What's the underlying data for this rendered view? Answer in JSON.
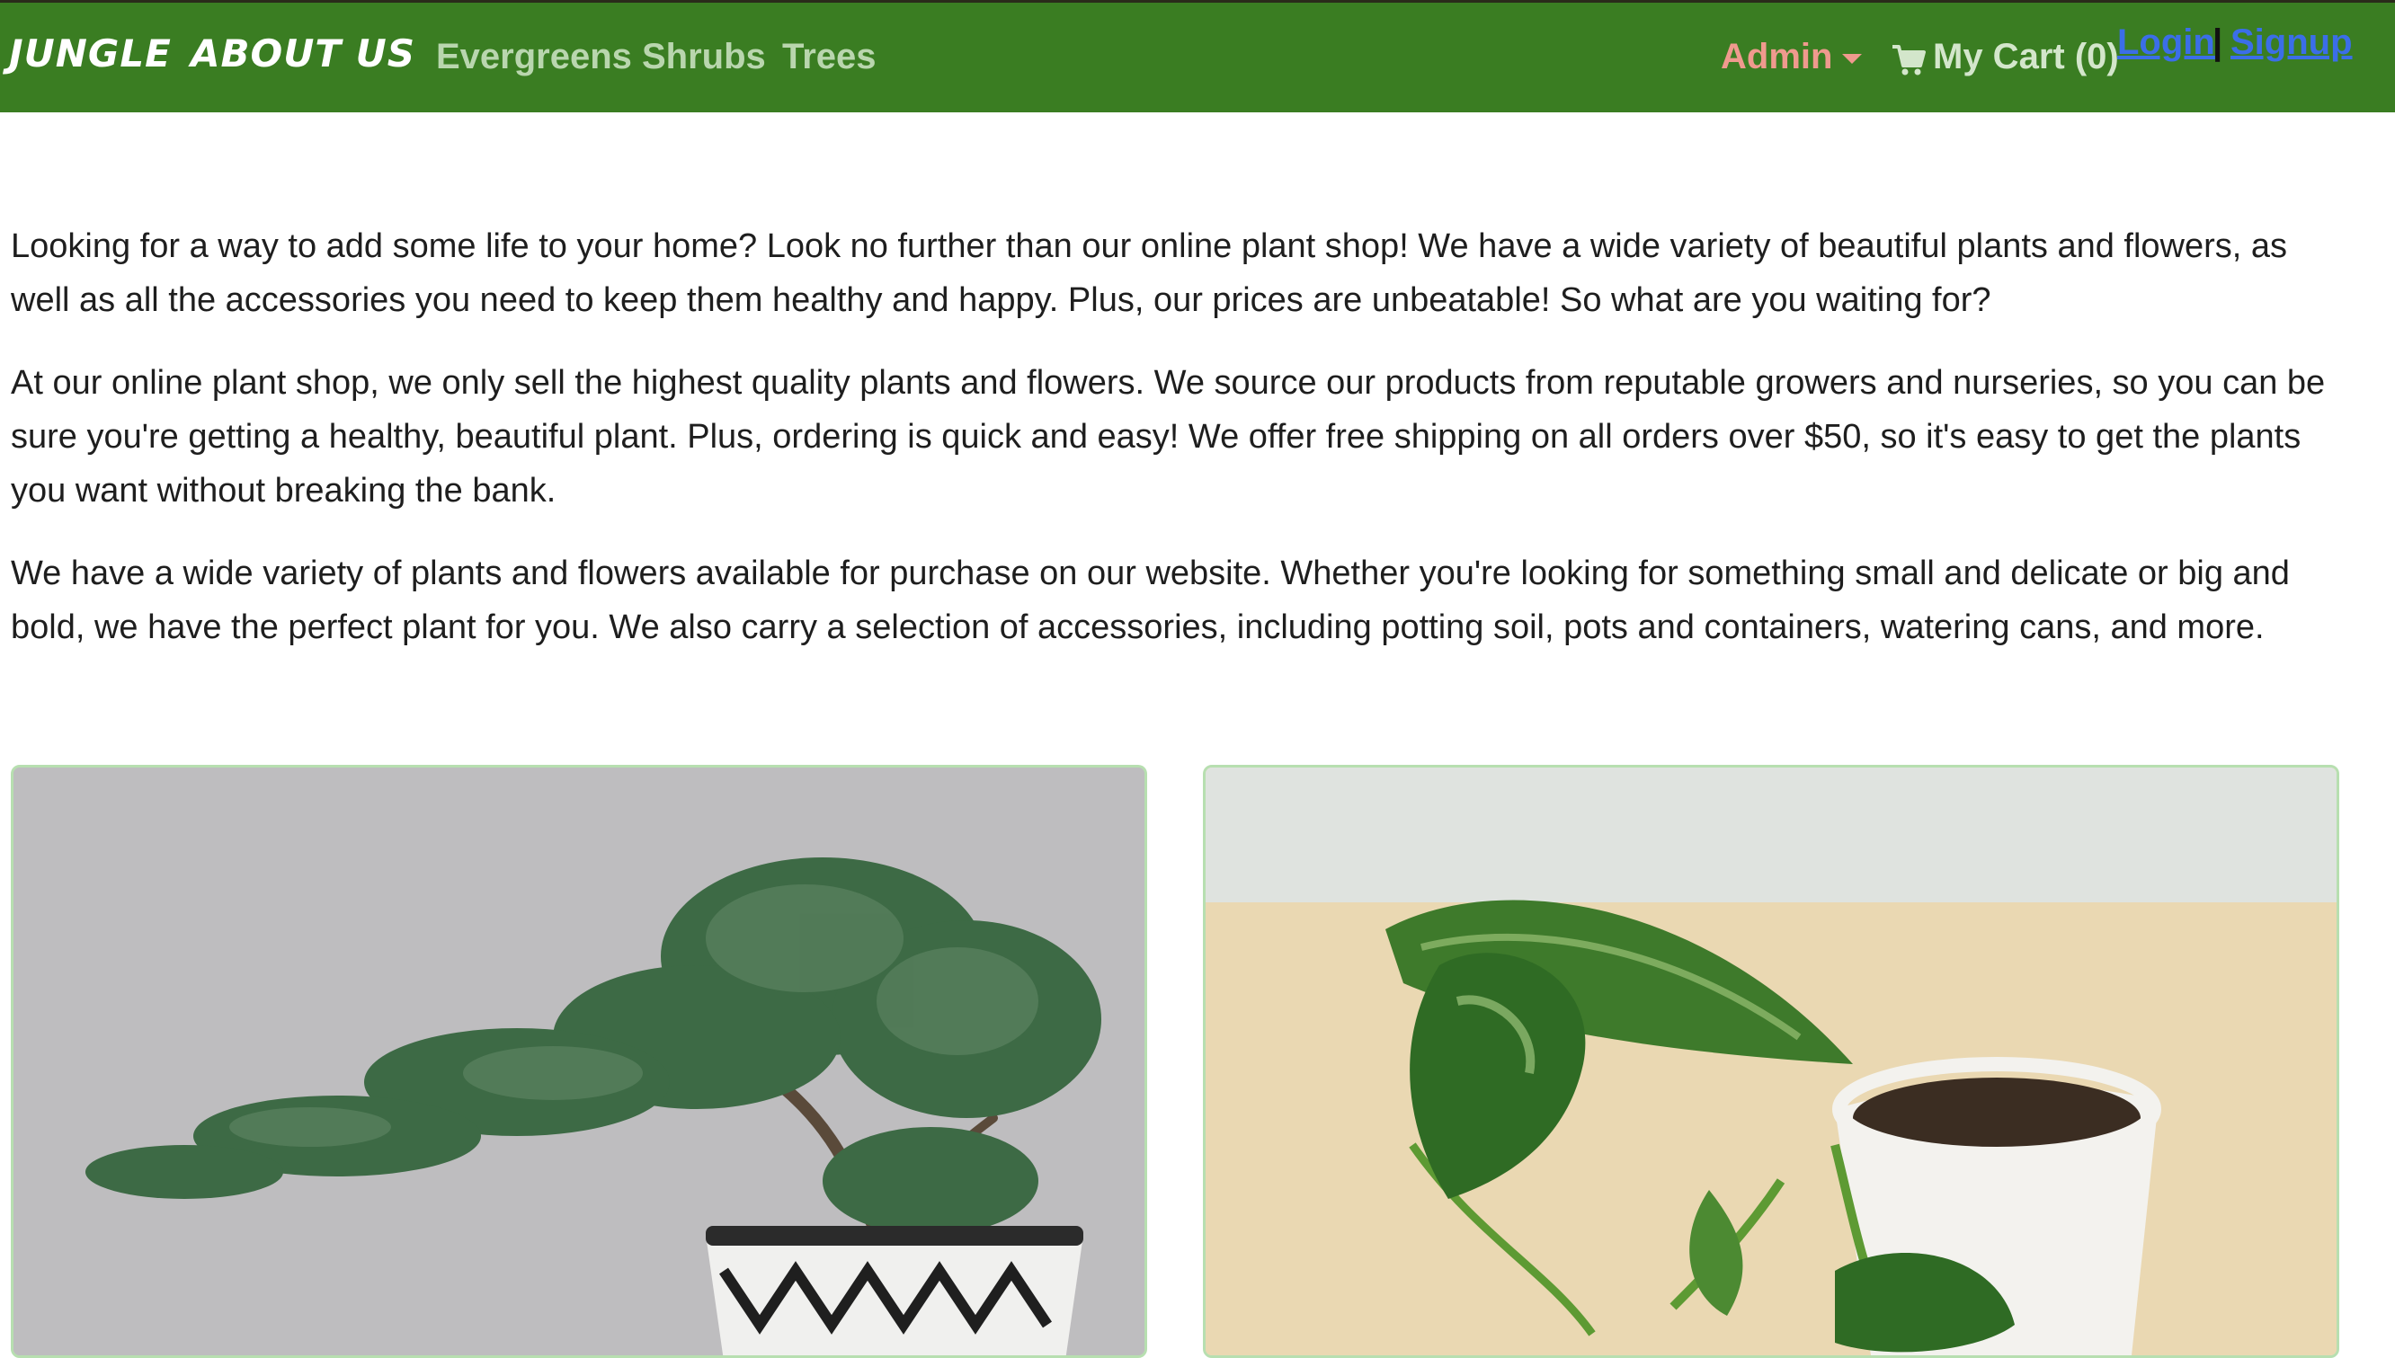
{
  "navbar": {
    "brand": "JUNGLE",
    "about": "ABOUT US",
    "links": [
      "Evergreens",
      "Shrubs",
      "Trees"
    ],
    "admin_label": "Admin",
    "cart_label": "My Cart (0)",
    "login_label": "Login",
    "separator": "|",
    "signup_label": "Signup",
    "colors": {
      "bar": "#3a7d22",
      "admin": "#ef9a8e",
      "auth_link": "#3b6ee8"
    }
  },
  "intro": {
    "paragraphs": [
      "Looking for a way to add some life to your home? Look no further than our online plant shop! We have a wide variety of beautiful plants and flowers, as well as all the accessories you need to keep them healthy and happy. Plus, our prices are unbeatable! So what are you waiting for?",
      "At our online plant shop, we only sell the highest quality plants and flowers. We source our products from reputable growers and nurseries, so you can be sure you're getting a healthy, beautiful plant. Plus, ordering is quick and easy! We offer free shipping on all orders over $50, so it's easy to get the plants you want without breaking the bank.",
      "We have a wide variety of plants and flowers available for purchase on our website. Whether you're looking for something small and delicate or big and bold, we have the perfect plant for you. We also carry a selection of accessories, including potting soil, pots and containers, watering cans, and more."
    ]
  },
  "products": [
    {
      "image_icon": "bonsai-plant-image"
    },
    {
      "image_icon": "pothos-plant-image"
    }
  ]
}
